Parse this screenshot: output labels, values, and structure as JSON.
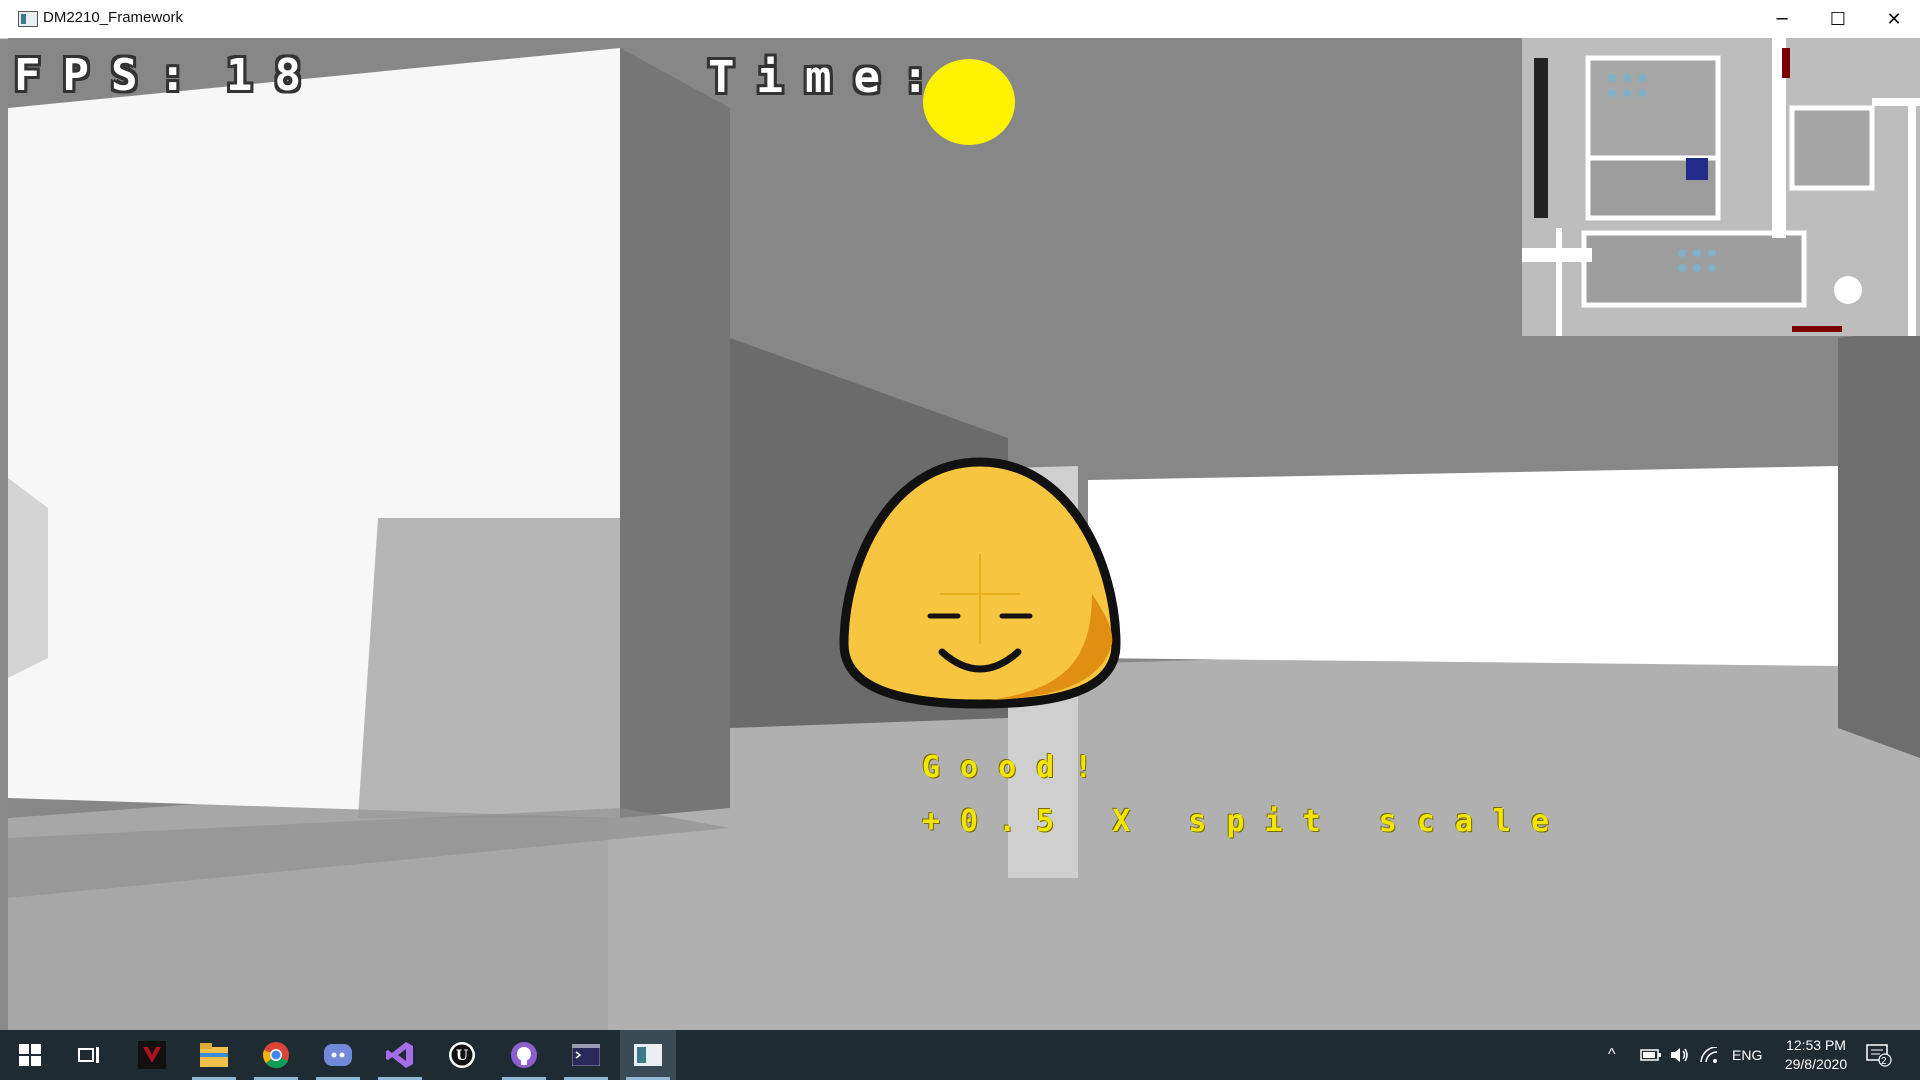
{
  "window": {
    "title": "DM2210_Framework",
    "minimize": "─",
    "maximize": "☐",
    "close": "✕"
  },
  "hud": {
    "fps_label": "FPS:",
    "fps_value": "18",
    "time_label": "Time:"
  },
  "feedback": {
    "rating": "Good!",
    "bonus": "+0.5 X spit scale"
  },
  "colors": {
    "sun": "#fff200",
    "text_yellow": "#f2e500",
    "face": "#f8c540",
    "taskbar": "#1f2b33"
  },
  "taskbar": {
    "apps": [
      "start-icon",
      "task-view-icon",
      "predator-icon",
      "file-explorer-icon",
      "chrome-icon",
      "discord-icon",
      "visual-studio-icon",
      "unreal-engine-icon",
      "github-icon",
      "terminal-icon",
      "dm2210-app-icon"
    ],
    "tray": {
      "chevron": "^",
      "language": "ENG",
      "time": "12:53 PM",
      "date": "29/8/2020",
      "notifications": "2"
    }
  }
}
